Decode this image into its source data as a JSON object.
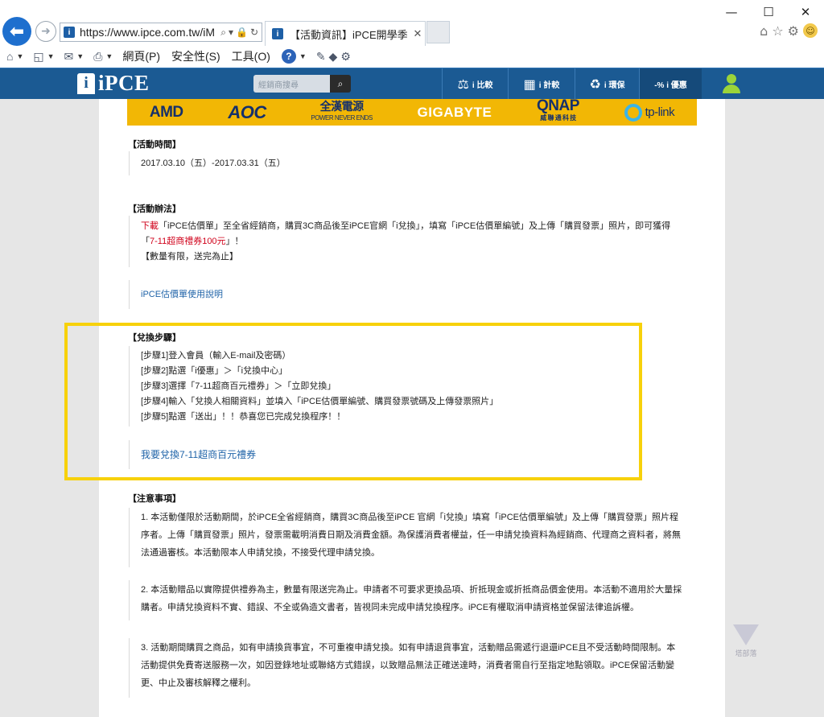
{
  "browser": {
    "url": "https://www.ipce.com.tw/iM",
    "tab_title": "【活動資訊】iPCE開學季 ...",
    "tab_close": "✕",
    "window_controls": {
      "minimize": "—",
      "maximize": "☐",
      "close": "✕"
    },
    "command_bar": {
      "page": "網頁(P)",
      "safety": "安全性(S)",
      "tools": "工具(O)"
    }
  },
  "site": {
    "logo_text": "iPCE",
    "search_placeholder": "經銷商搜尋",
    "nav": [
      {
        "label": "i 比較",
        "icon": "balance-icon"
      },
      {
        "label": "i 計較",
        "icon": "calculator-icon"
      },
      {
        "label": "i 環保",
        "icon": "recycle-icon"
      },
      {
        "label": "-% i 優惠",
        "icon": "discount-icon"
      }
    ]
  },
  "sponsors": [
    "AMD",
    "AOC",
    "全漢電源",
    "POWER NEVER ENDS",
    "GIGABYTE",
    "QNAP",
    "威 聯 通 科 技",
    "tp-link"
  ],
  "article": {
    "time": {
      "heading": "【活動時間】",
      "value": "2017.03.10（五）-2017.03.31（五）"
    },
    "method": {
      "heading": "【活動辦法】",
      "download": "下載",
      "text1": "「iPCE估價單」至全省經銷商，購買3C商品後至iPCE官網「i兌換」，填寫「iPCE估價單編號」及上傳「購買發票」照片，即可獲得",
      "quote_open": "「",
      "coupon": "7-11超商禮券100元",
      "quote_close": "」！",
      "limit": "【數量有限，送完為止】"
    },
    "guide_link": "iPCE估價單使用說明",
    "steps": {
      "heading": "【兌換步驟】",
      "items": [
        "[步驟1]登入會員（輸入E-mail及密碼）",
        "[步驟2]點選「i優惠」＞「i兌換中心」",
        "[步驟3]選擇「7-11超商百元禮券」＞「立即兌換」",
        "[步驟4]輸入「兌換人相關資料」並填入「iPCE估價單編號、購買發票號碼及上傳發票照片」",
        "[步驟5]點選「送出」！！恭喜您已完成兌換程序！！"
      ],
      "redeem_link": "我要兌換7-11超商百元禮券"
    },
    "notes": {
      "heading": "【注意事項】",
      "items": [
        "1. 本活動僅限於活動期間，於iPCE全省經銷商，購買3C商品後至iPCE 官網「i兌換」填寫「iPCE估價單編號」及上傳「購買發票」照片程序者。上傳「購買發票」照片，發票需載明消費日期及消費金額。為保護消費者權益，任一申請兌換資料為經銷商、代理商之資料者，將無法通過審核。本活動限本人申請兌換，不接受代理申請兌換。",
        "2. 本活動贈品以實際提供禮券為主，數量有限送完為止。申請者不可要求更換品項、折抵現金或折抵商品價金使用。本活動不適用於大量採購者。申請兌換資料不實、錯誤、不全或偽造文書者，皆視同未完成申請兌換程序。iPCE有權取消申請資格並保留法律追訴權。",
        "3. 活動期間購買之商品，如有申請換貨事宜，不可重複申請兌換。如有申請退貨事宜，活動贈品需遞行退還iPCE且不受活動時間限制。本活動提供免費寄送服務一次，如因登錄地址或聯絡方式錯誤，以致贈品無法正確送達時，消費者需自行至指定地點領取。iPCE保留活動變更、中止及審核解釋之權利。"
      ]
    }
  },
  "watermark_text": "塔部落"
}
